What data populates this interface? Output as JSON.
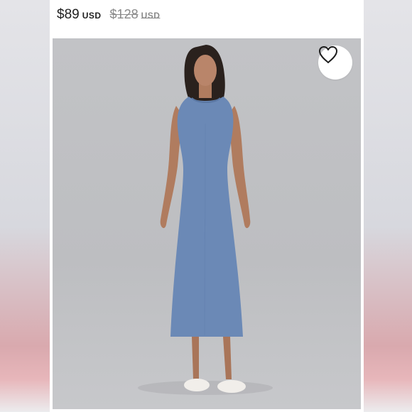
{
  "product": {
    "price": "$89",
    "price_currency": "USD",
    "original_price": "$128",
    "original_currency": "USD"
  },
  "image": {
    "dress_color": "#6b89b6",
    "background_color": "#c0c1c4"
  },
  "wishlist": {
    "icon": "heart-outline-icon"
  }
}
